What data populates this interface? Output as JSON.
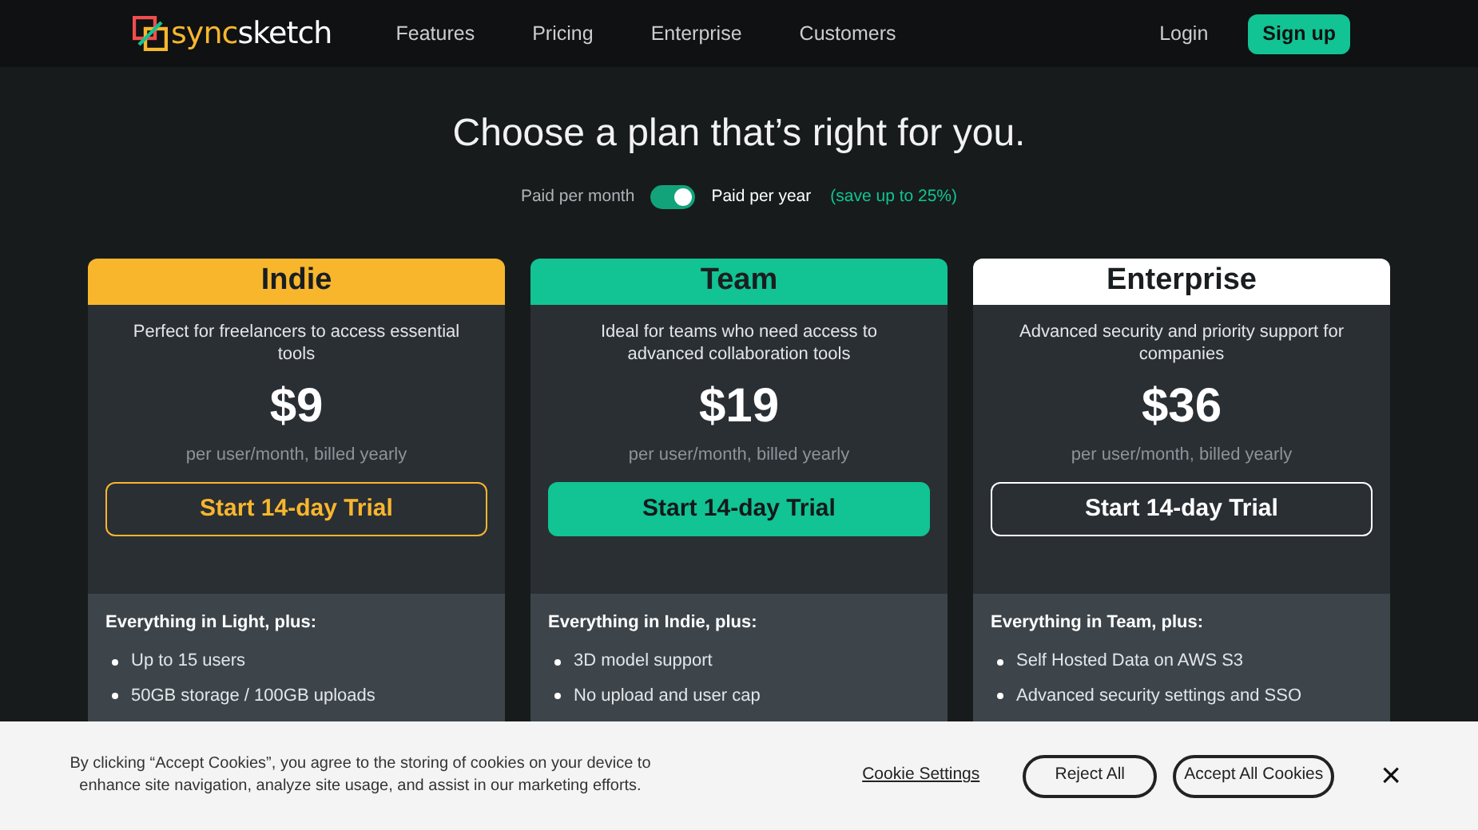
{
  "nav": {
    "logo_accent": "sync",
    "logo_rest": "sketch",
    "links": [
      "Features",
      "Pricing",
      "Enterprise",
      "Customers"
    ],
    "login": "Login",
    "signup": "Sign up"
  },
  "title": "Choose a plan that’s right for you.",
  "billing": {
    "monthly_label": "Paid per month",
    "yearly_label": "Paid per year",
    "on": true,
    "save_note": "(save up to 25%)"
  },
  "plans": [
    {
      "name": "Indie",
      "color": "#f8b62d",
      "description": "Perfect for freelancers to access essential tools",
      "price": "$9",
      "price_note": "per user/month, billed yearly",
      "button": {
        "label": "Start 14-day Trial",
        "kind": "outline"
      },
      "features_heading": "Everything in Light, plus:",
      "features": [
        "Up to 15 users",
        "50GB storage / 100GB uploads"
      ]
    },
    {
      "name": "Team",
      "color": "#12c393",
      "description": "Ideal for teams who need access to advanced collaboration tools",
      "price": "$19",
      "price_note": "per user/month, billed yearly",
      "button": {
        "label": "Start 14-day Trial",
        "kind": "filled"
      },
      "features_heading": "Everything in Indie, plus:",
      "features": [
        "3D model support",
        "No upload and user cap"
      ]
    },
    {
      "name": "Enterprise",
      "color": "#ffffff",
      "description": "Advanced security and priority support for companies",
      "price": "$36",
      "price_note": "per user/month, billed yearly",
      "button": {
        "label": "Start 14-day Trial",
        "kind": "outline"
      },
      "features_heading": "Everything in Team, plus:",
      "features": [
        "Self Hosted Data on AWS S3",
        "Advanced security settings and SSO"
      ]
    }
  ],
  "cookie_banner": {
    "text": "By clicking “Accept Cookies”, you agree to the storing of cookies on your device to enhance site navigation, analyze site usage, and assist in our marketing efforts.",
    "settings": "Cookie Settings",
    "reject": "Reject All",
    "accept": "Accept All Cookies",
    "close": "×"
  }
}
